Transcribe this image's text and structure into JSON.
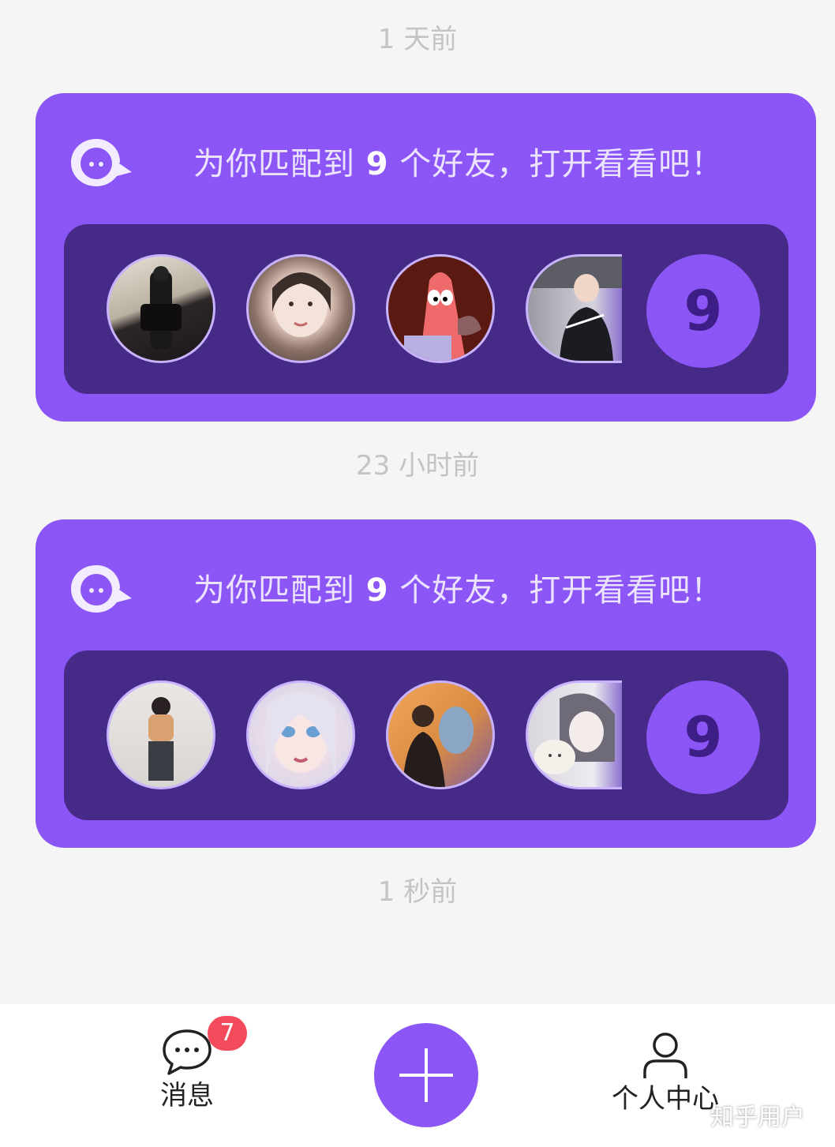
{
  "feed": {
    "messages": [
      {
        "time": "1 天前",
        "title_prefix": "为你匹配到",
        "match_count": "9",
        "title_suffix": "个好友，打开看看吧！",
        "avatars": [
          "friend-1",
          "friend-2",
          "friend-3",
          "friend-4"
        ],
        "more_count": "9"
      },
      {
        "time": "23 小时前",
        "title_prefix": "为你匹配到",
        "match_count": "9",
        "title_suffix": "个好友，打开看看吧！",
        "avatars": [
          "friend-5",
          "friend-6",
          "friend-7",
          "friend-8"
        ],
        "more_count": "9"
      }
    ],
    "latest_time": "1 秒前"
  },
  "nav": {
    "messages_label": "消息",
    "messages_badge": "7",
    "profile_label": "个人中心",
    "add_icon": "plus-icon"
  },
  "watermark": "知乎用户",
  "colors": {
    "accent": "#8c55f6",
    "panel": "#452a87",
    "badge": "#f34b5b"
  }
}
